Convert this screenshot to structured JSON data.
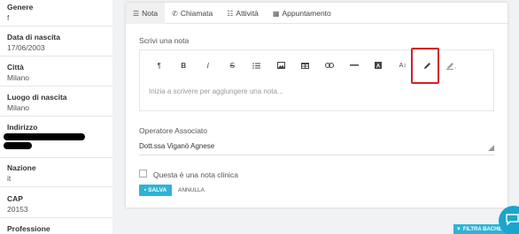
{
  "profile": {
    "fields": [
      {
        "label": "Genere",
        "value": "f"
      },
      {
        "label": "Data di nascita",
        "value": "17/06/2003"
      },
      {
        "label": "Città",
        "value": "Milano"
      },
      {
        "label": "Luogo di nascita",
        "value": "Milano"
      },
      {
        "label": "Indirizzo",
        "value": ""
      },
      {
        "label": "Nazione",
        "value": "it"
      },
      {
        "label": "CAP",
        "value": "20153"
      },
      {
        "label": "Professione",
        "value": ""
      }
    ]
  },
  "tabs": [
    {
      "label": "Nota",
      "icon": "note-icon",
      "active": true
    },
    {
      "label": "Chiamata",
      "icon": "phone-icon",
      "active": false
    },
    {
      "label": "Attività",
      "icon": "list-icon",
      "active": false
    },
    {
      "label": "Appuntamento",
      "icon": "calendar-icon",
      "active": false
    }
  ],
  "note": {
    "label": "Scrivi una nota",
    "placeholder": "Inizia a scrivere per aggiungere una nota...",
    "toolbar": [
      "paragraph-icon",
      "bold-icon",
      "italic-icon",
      "strikethrough-icon",
      "bullet-list-icon",
      "image-icon",
      "table-icon",
      "link-icon",
      "horizontal-rule-icon",
      "text-color-icon",
      "font-size-icon",
      "pencil-icon",
      "clear-format-icon"
    ]
  },
  "operator": {
    "label": "Operatore Associato",
    "value": "Dott.ssa Viganò Agnese"
  },
  "clinical": {
    "label": "Questa è una nota clinica",
    "checked": false
  },
  "actions": {
    "save": "SALVA",
    "cancel": "ANNULLA"
  },
  "filter_button": "FILTRA BACHECA",
  "colors": {
    "accent": "#2eb3d6",
    "highlight": "#d0202a"
  }
}
